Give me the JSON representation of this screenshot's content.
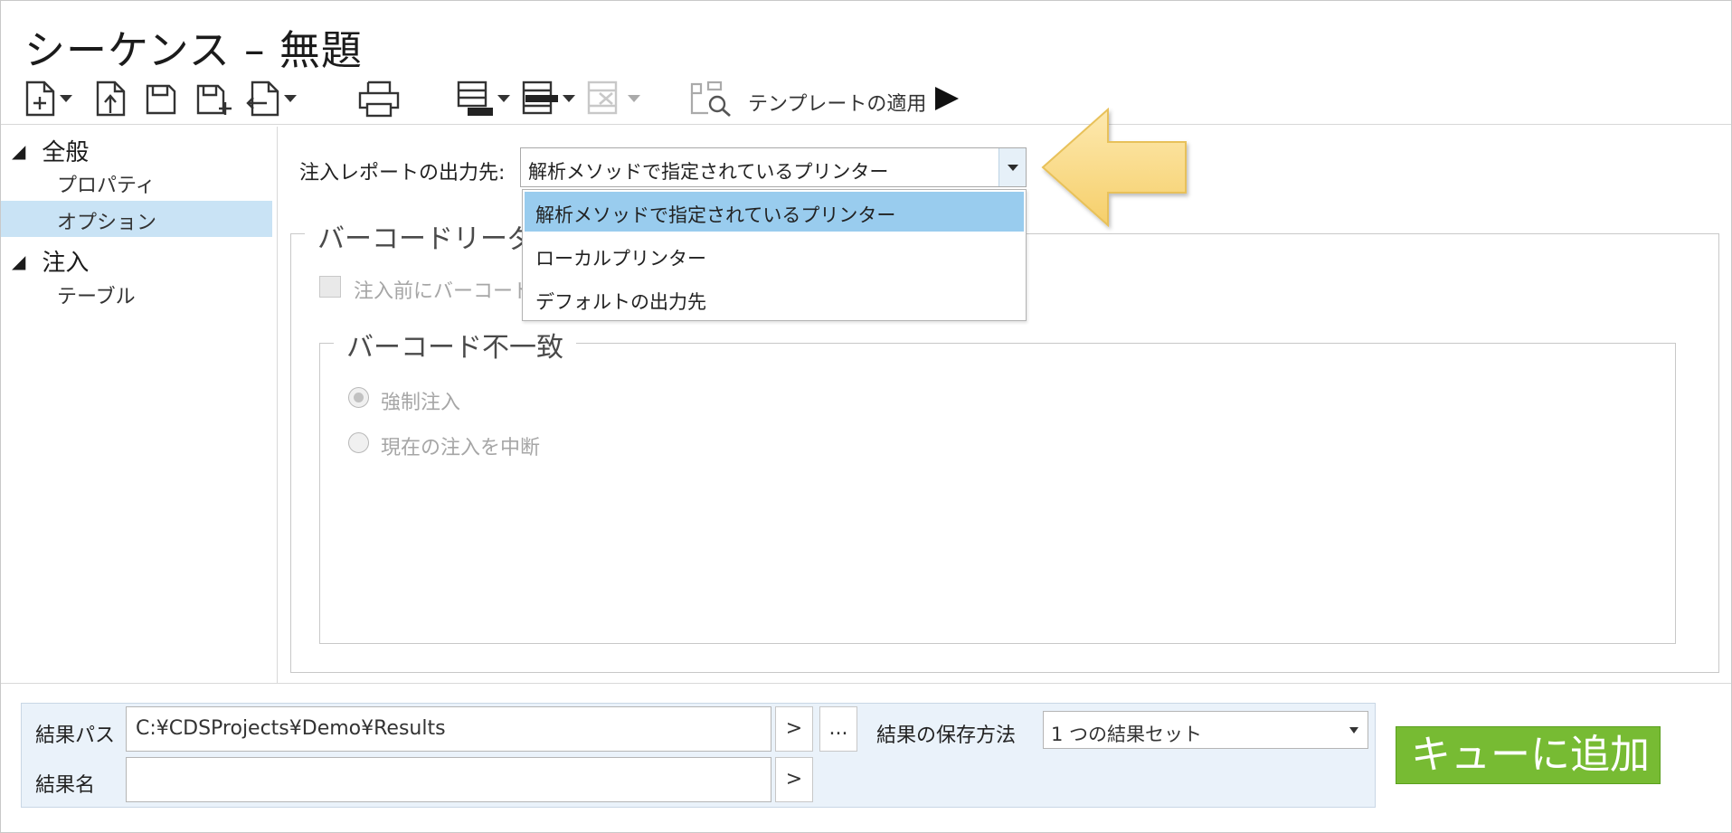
{
  "window": {
    "title": "シーケンス – 無題"
  },
  "toolbar": {
    "template_label": "テンプレートの適用",
    "icons": [
      "new-doc-icon",
      "open-doc-icon",
      "save-icon",
      "save-as-icon",
      "import-icon",
      "print-icon",
      "insert-row-above-icon",
      "insert-row-below-icon",
      "delete-row-icon",
      "template-icon",
      "play-icon"
    ]
  },
  "sidebar": {
    "groups": [
      {
        "label": "全般",
        "items": [
          "プロパティ",
          "オプション"
        ]
      },
      {
        "label": "注入",
        "items": [
          "テーブル"
        ]
      }
    ],
    "selected": "オプション"
  },
  "options": {
    "report_output_label": "注入レポートの出力先:",
    "report_output_value": "解析メソッドで指定されているプリンター",
    "dropdown_options": [
      "解析メソッドで指定されているプリンター",
      "ローカルプリンター",
      "デフォルトの出力先"
    ],
    "barcode_reader_title": "バーコードリーダ",
    "barcode_check_label": "注入前にバーコード",
    "barcode_mismatch_title": "バーコード不一致",
    "radio_force": "強制注入",
    "radio_abort": "現在の注入を中断"
  },
  "bottom": {
    "result_path_label": "結果パス",
    "result_path_value": "C:¥CDSProjects¥Demo¥Results",
    "result_name_label": "結果名",
    "result_name_value": "",
    "next_label": ">",
    "browse_label": "...",
    "save_method_label": "結果の保存方法",
    "save_method_value": "1 つの結果セット",
    "queue_button": "キューに追加"
  },
  "colors": {
    "selection": "#c9e3f5",
    "dropdown_highlight": "#99ccee",
    "callout_arrow": "#fbe09a",
    "queue_button": "#77bb33",
    "bottom_panel": "#eaf2fa"
  }
}
